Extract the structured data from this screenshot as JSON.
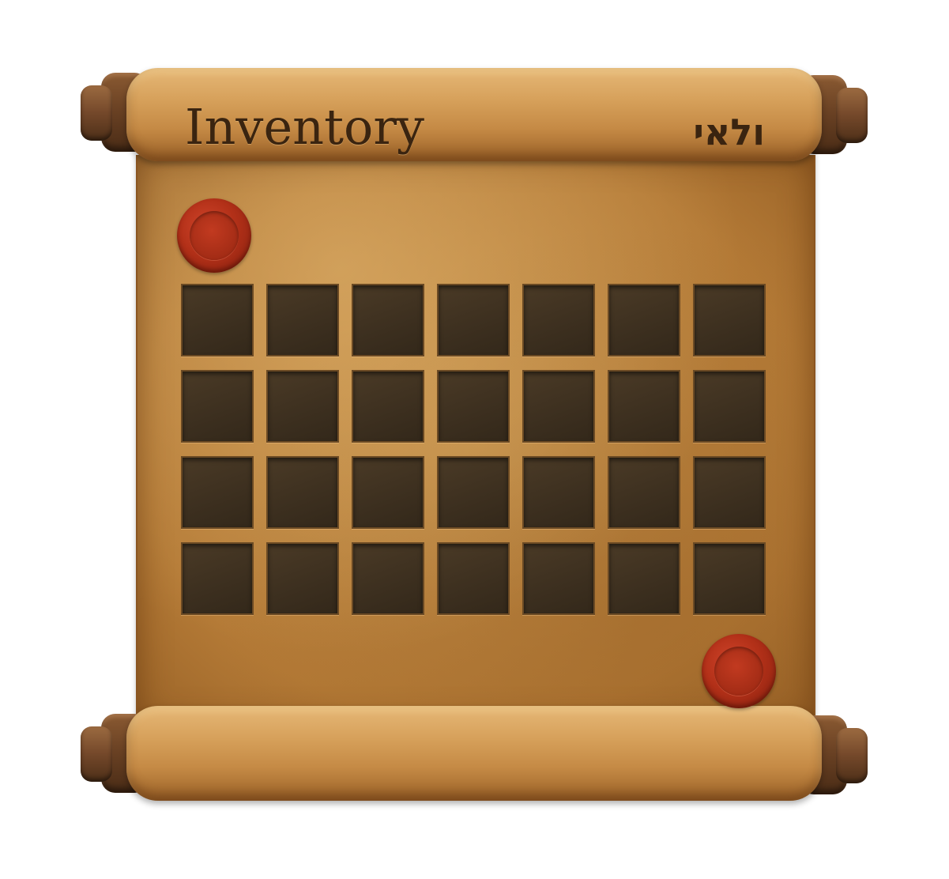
{
  "window": {
    "title": "Inventory",
    "hebrew_label": "ולאי"
  },
  "inventory": {
    "rows": 4,
    "columns": 7,
    "slots": [
      {
        "item": ""
      },
      {
        "item": ""
      },
      {
        "item": ""
      },
      {
        "item": ""
      },
      {
        "item": ""
      },
      {
        "item": ""
      },
      {
        "item": ""
      },
      {
        "item": ""
      },
      {
        "item": ""
      },
      {
        "item": ""
      },
      {
        "item": ""
      },
      {
        "item": ""
      },
      {
        "item": ""
      },
      {
        "item": ""
      },
      {
        "item": ""
      },
      {
        "item": ""
      },
      {
        "item": ""
      },
      {
        "item": ""
      },
      {
        "item": ""
      },
      {
        "item": ""
      },
      {
        "item": ""
      },
      {
        "item": ""
      },
      {
        "item": ""
      },
      {
        "item": ""
      },
      {
        "item": ""
      },
      {
        "item": ""
      },
      {
        "item": ""
      },
      {
        "item": ""
      }
    ]
  },
  "decorations": {
    "seal_color": "#b23018",
    "parchment_color": "#c58f48",
    "slot_color": "#3c2f1f",
    "icons": [
      "wax-seal-icon",
      "scroll-roller-icon"
    ]
  }
}
